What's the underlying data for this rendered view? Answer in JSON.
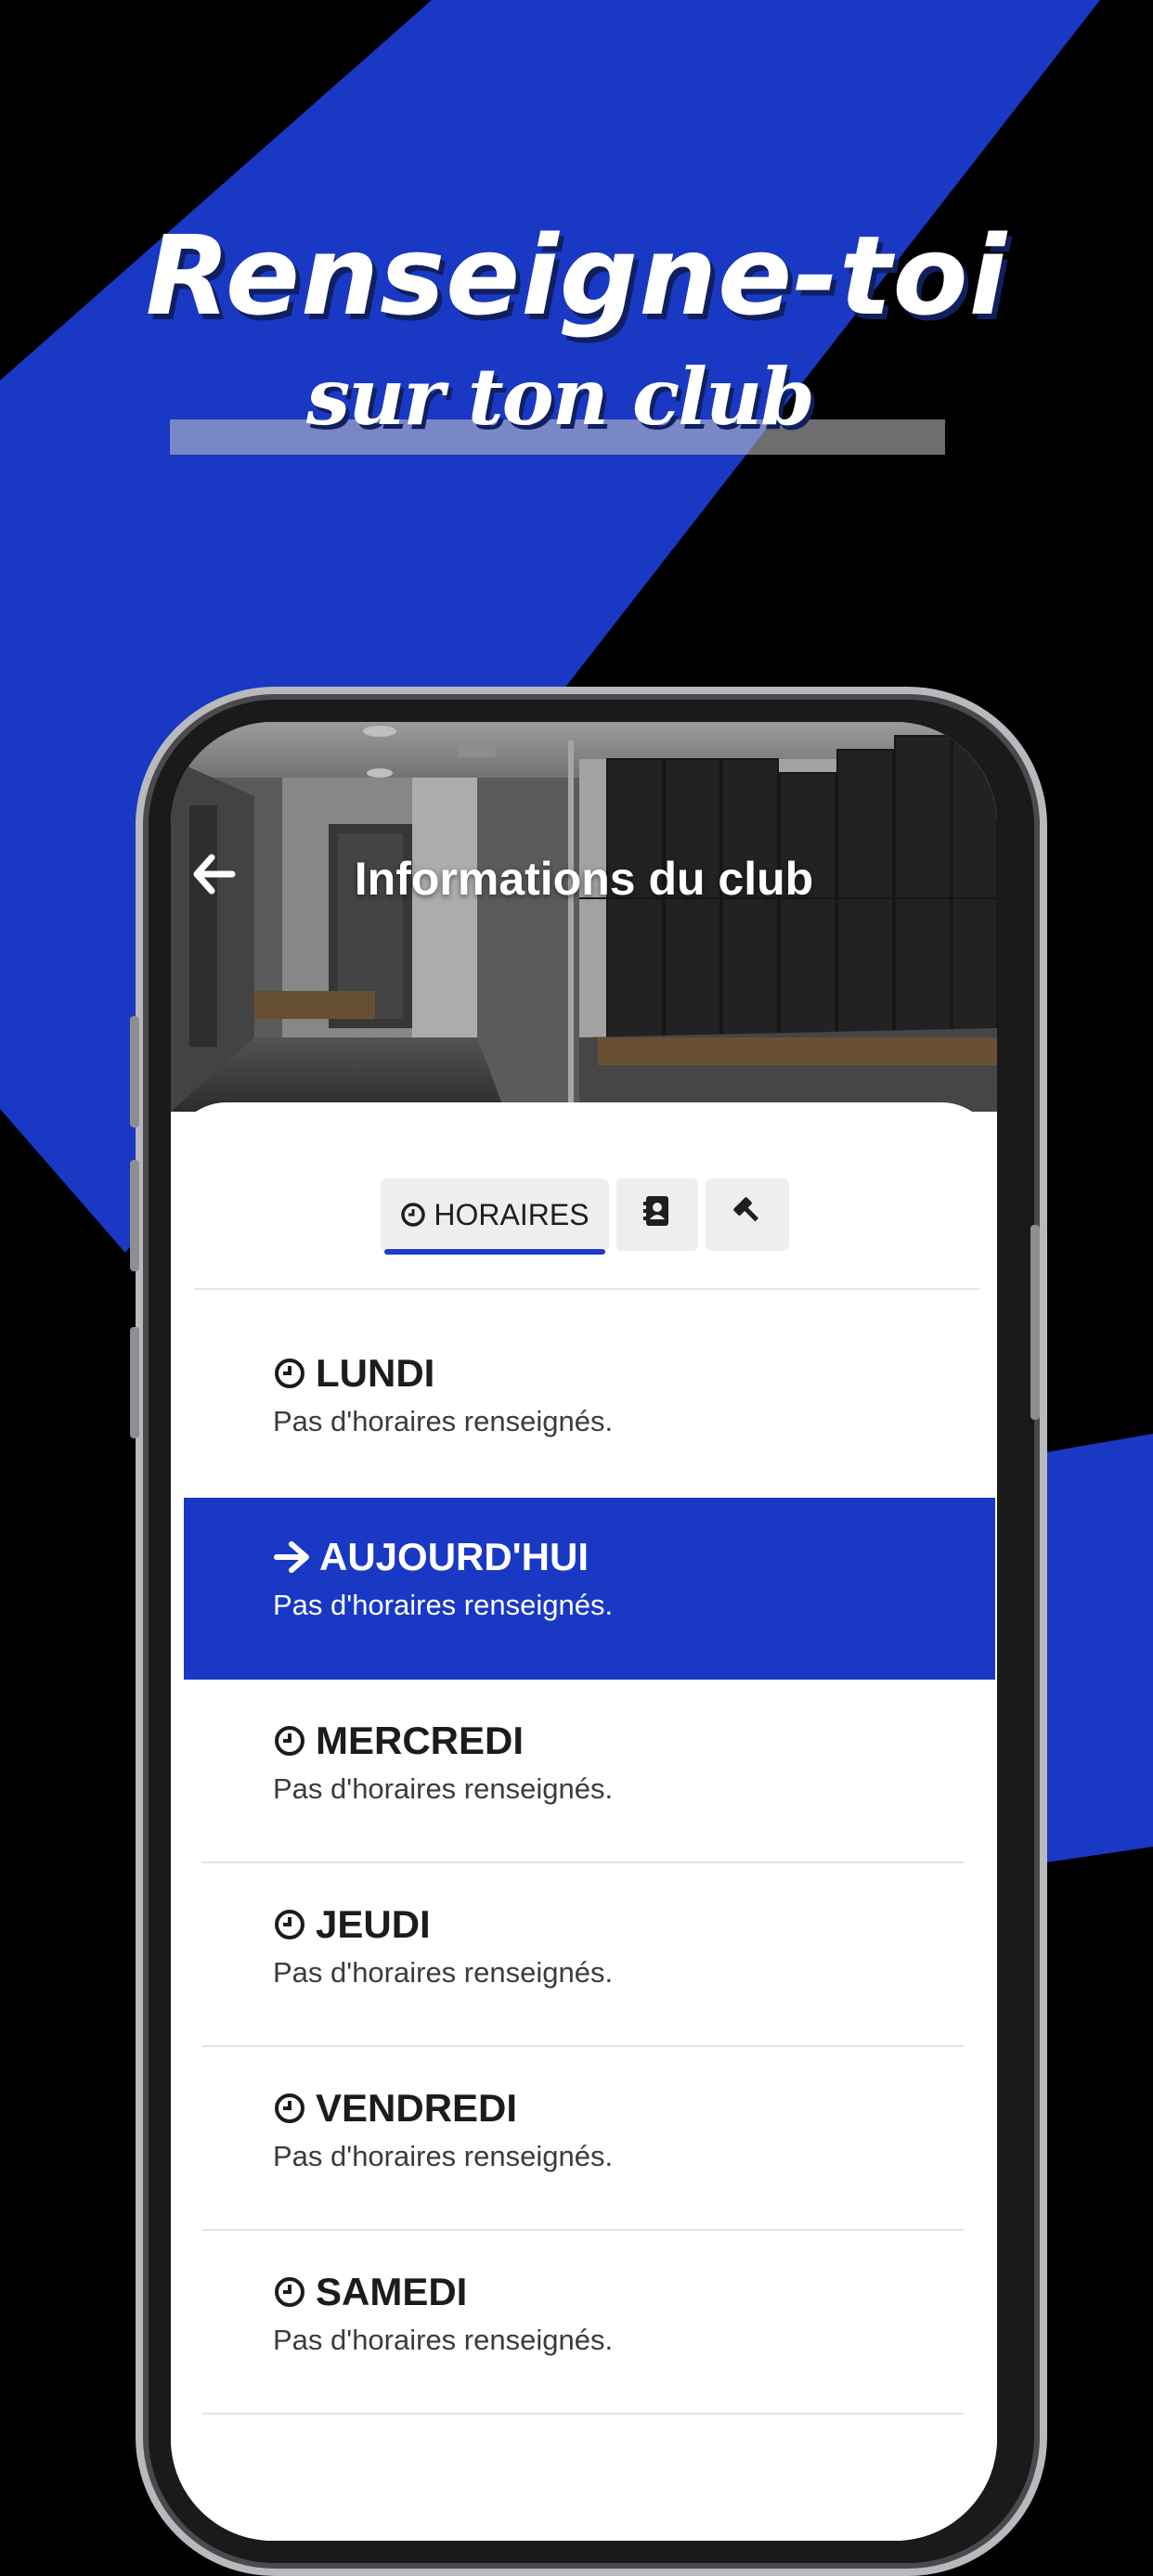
{
  "colors": {
    "accent_blue": "#1938c4",
    "background": "#000000",
    "text_dark": "#1c1c1c"
  },
  "promo": {
    "headline": "Renseigne-toi",
    "subline": "sur ton club"
  },
  "screen": {
    "title": "Informations du club",
    "back_icon": "arrow-left-icon",
    "tabs": [
      {
        "label": "HORAIRES",
        "icon": "clock-icon",
        "active": true
      },
      {
        "label": "",
        "icon": "contact-book-icon",
        "active": false
      },
      {
        "label": "",
        "icon": "gavel-icon",
        "active": false
      }
    ],
    "days": [
      {
        "name": "LUNDI",
        "note": "Pas d'horaires renseignés.",
        "icon": "clock-icon",
        "today": false
      },
      {
        "name": "AUJOURD'HUI",
        "note": "Pas d'horaires renseignés.",
        "icon": "arrow-right-icon",
        "today": true
      },
      {
        "name": "MERCREDI",
        "note": "Pas d'horaires renseignés.",
        "icon": "clock-icon",
        "today": false
      },
      {
        "name": "JEUDI",
        "note": "Pas d'horaires renseignés.",
        "icon": "clock-icon",
        "today": false
      },
      {
        "name": "VENDREDI",
        "note": "Pas d'horaires renseignés.",
        "icon": "clock-icon",
        "today": false
      },
      {
        "name": "SAMEDI",
        "note": "Pas d'horaires renseignés.",
        "icon": "clock-icon",
        "today": false
      }
    ]
  }
}
